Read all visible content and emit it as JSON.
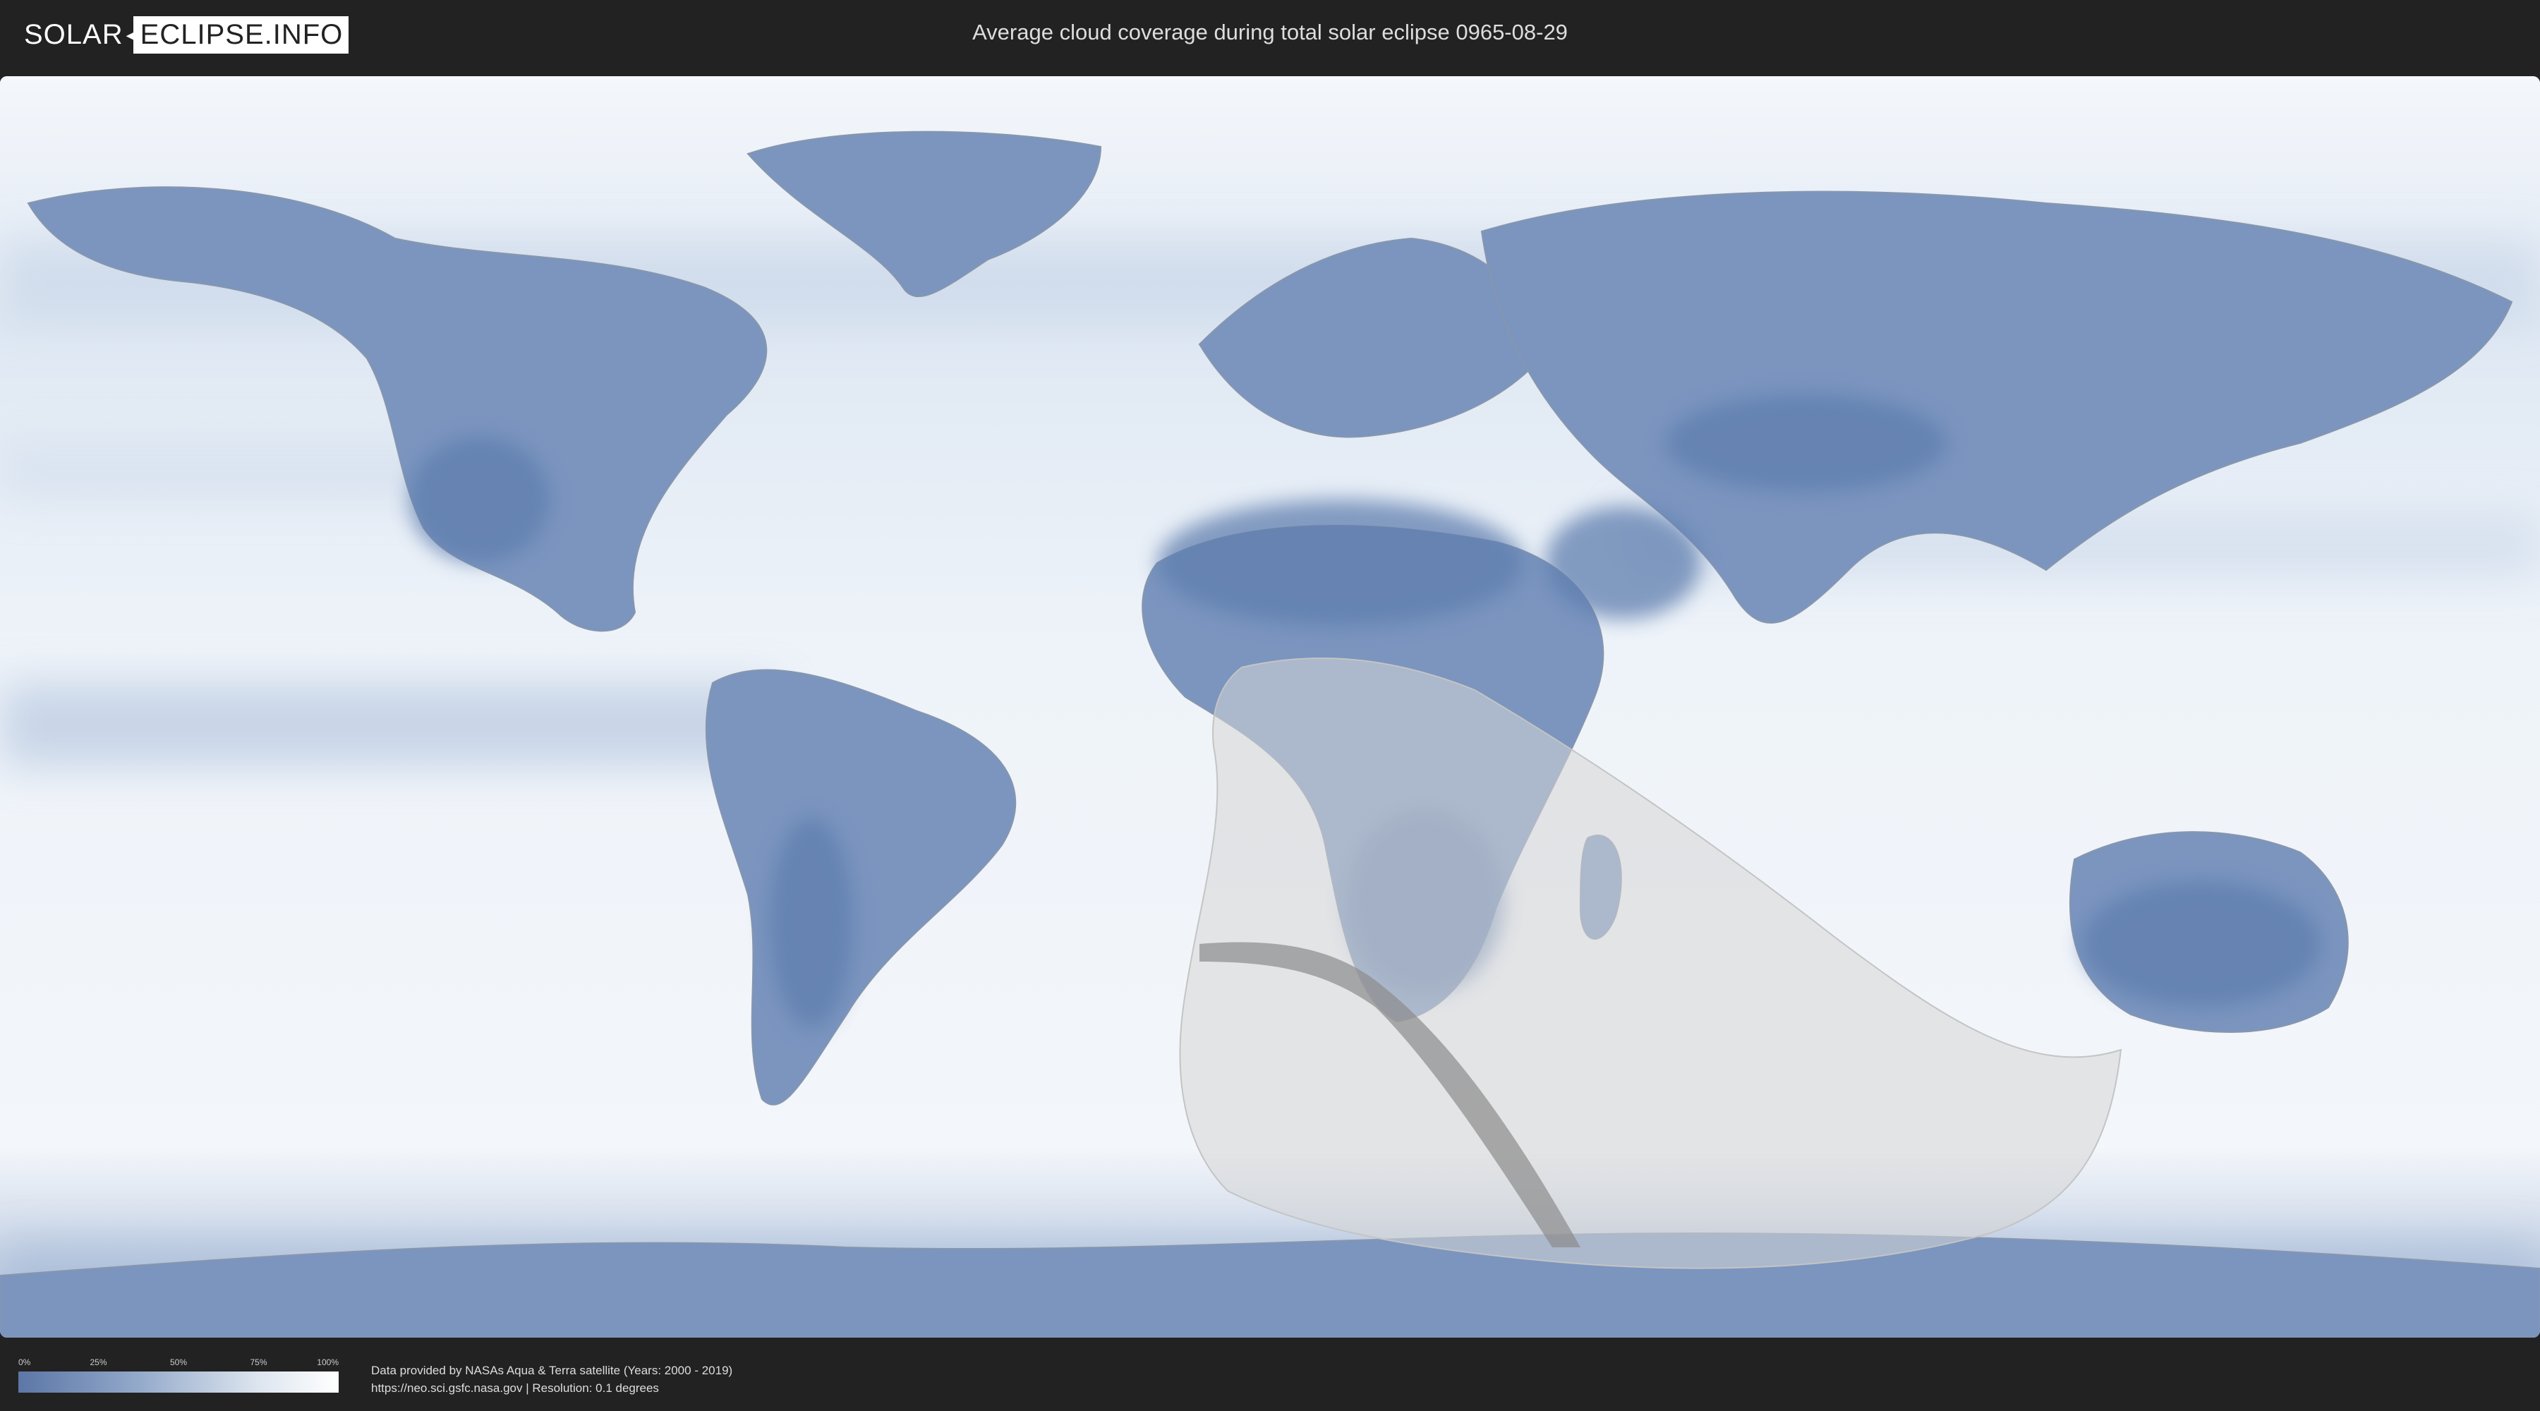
{
  "header": {
    "logo_left": "SOLAR",
    "logo_right": "ECLIPSE.INFO",
    "title": "Average cloud coverage during total solar eclipse 0965-08-29"
  },
  "map": {
    "ocean_color": "#e9f0f8",
    "land_cloud_color": "#5f7eae",
    "visibility_zone_color": "#d8d8d8",
    "eclipse_path_color": "#8c8c8c"
  },
  "legend": {
    "ticks": [
      "0%",
      "25%",
      "50%",
      "75%",
      "100%"
    ],
    "gradient": [
      "#5c76a6",
      "#8fa6c8",
      "#dde5ef",
      "#ffffff"
    ]
  },
  "footer": {
    "credit_line1": "Data provided by NASAs Aqua & Terra satellite (Years: 2000 - 2019)",
    "credit_line2": "https://neo.sci.gsfc.nasa.gov | Resolution: 0.1 degrees"
  }
}
